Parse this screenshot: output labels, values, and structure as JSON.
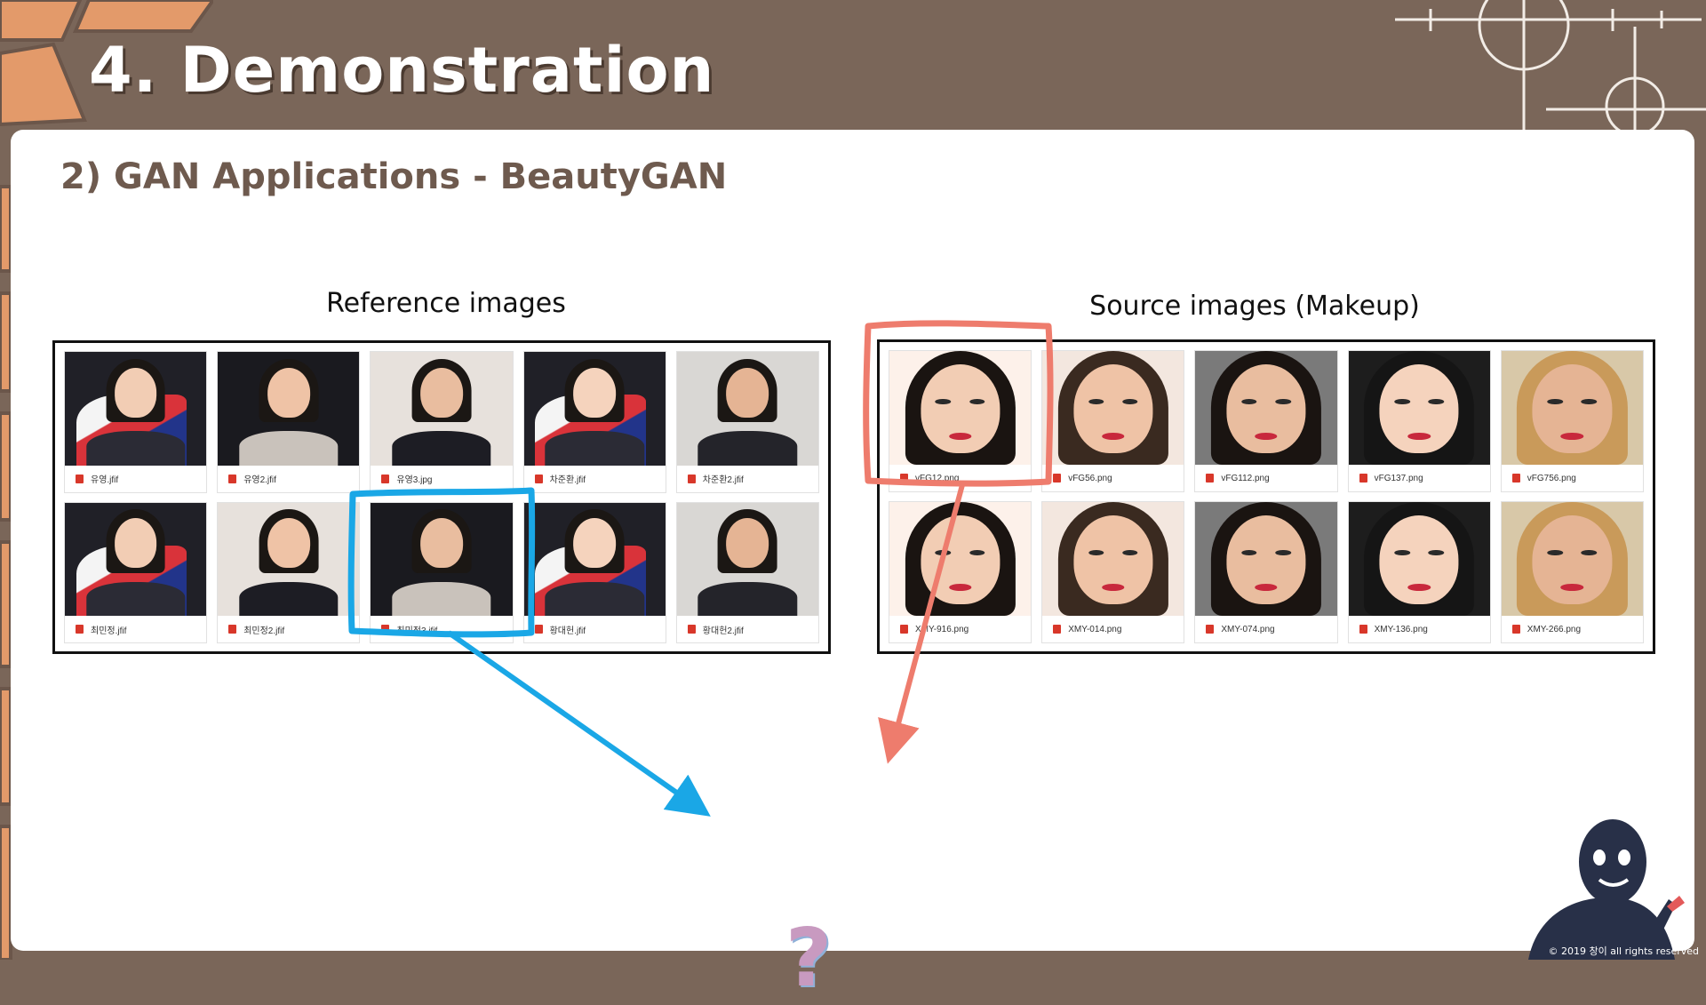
{
  "slide": {
    "title": "4. Demonstration",
    "subtitle": "2) GAN Applications - BeautyGAN",
    "question_mark": "?",
    "copyright": "© 2019 창이 all rights reserved"
  },
  "reference": {
    "label": "Reference images",
    "highlight_color": "#1aa7e6",
    "items": [
      {
        "name": "유영.jfif",
        "photo": "flag-portrait"
      },
      {
        "name": "유영2.jfif",
        "photo": "dark-portrait"
      },
      {
        "name": "유영3.jpg",
        "photo": "light-portrait"
      },
      {
        "name": "차준환.jfif",
        "photo": "flag-fullbody"
      },
      {
        "name": "차준환2.jfif",
        "photo": "man-portrait"
      },
      {
        "name": "최민정.jfif",
        "photo": "flag-portrait"
      },
      {
        "name": "최민정2.jfif",
        "photo": "light-portrait"
      },
      {
        "name": "최민정3.jfif",
        "photo": "dark-portrait"
      },
      {
        "name": "황대헌.jfif",
        "photo": "flag-fullbody"
      },
      {
        "name": "황대헌2.jfif",
        "photo": "man-portrait"
      }
    ]
  },
  "source": {
    "label": "Source images (Makeup)",
    "highlight_color": "#ee7c6d",
    "items": [
      {
        "name": "vFG12.png",
        "photo": "makeup"
      },
      {
        "name": "vFG56.png",
        "photo": "makeup"
      },
      {
        "name": "vFG112.png",
        "photo": "makeup"
      },
      {
        "name": "vFG137.png",
        "photo": "makeup"
      },
      {
        "name": "vFG756.png",
        "photo": "makeup"
      },
      {
        "name": "XMY-916.png",
        "photo": "makeup"
      },
      {
        "name": "XMY-014.png",
        "photo": "makeup"
      },
      {
        "name": "XMY-074.png",
        "photo": "makeup"
      },
      {
        "name": "XMY-136.png",
        "photo": "makeup"
      },
      {
        "name": "XMY-266.png",
        "photo": "makeup"
      }
    ]
  },
  "colors": {
    "background": "#7a6659",
    "brick": "#e39a6a",
    "panel": "#ffffff",
    "subtitle": "#6e5a4e",
    "question_mark": "#c89ac0"
  }
}
